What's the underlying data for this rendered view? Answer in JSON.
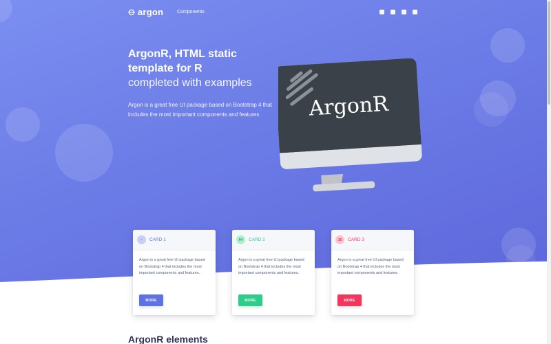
{
  "brand": {
    "name": "argon"
  },
  "nav": {
    "components_label": "Components"
  },
  "social": [
    "facebook-icon",
    "instagram-icon",
    "twitter-icon",
    "github-icon"
  ],
  "hero": {
    "title_line1": "ArgonR, HTML static",
    "title_line2": "template for R",
    "subtitle": "completed with examples",
    "lead": "Argon is a great free UI package based on Bootstrap 4 that includes the most important components and features"
  },
  "monitor": {
    "screen_text": "ArgonR"
  },
  "cards": [
    {
      "icon_text": "✓",
      "title": "CARD 1",
      "body": "Argon is a great free UI package based on Bootstrap 4 that includes the most important components and features.",
      "button": "MORE",
      "color": "#5e72e4",
      "icon_bg": "#c9d0f7"
    },
    {
      "icon_text": "64",
      "title": "CARD 2",
      "body": "Argon is a great free UI package based on Bootstrap 4 that includes the most important components and features.",
      "button": "MORE",
      "color": "#2dce89",
      "icon_bg": "#b0eecf"
    },
    {
      "icon_text": "16",
      "title": "CARD 3",
      "body": "Argon is a great free UI package based on Bootstrap 4 that includes the most important components and features.",
      "button": "MORE",
      "color": "#f5365c",
      "icon_bg": "#fbc3ce"
    }
  ],
  "sections": {
    "elements_title": "ArgonR elements"
  },
  "colors": {
    "primary": "#5e72e4",
    "success": "#2dce89",
    "danger": "#f5365c",
    "heading": "#32325d"
  }
}
